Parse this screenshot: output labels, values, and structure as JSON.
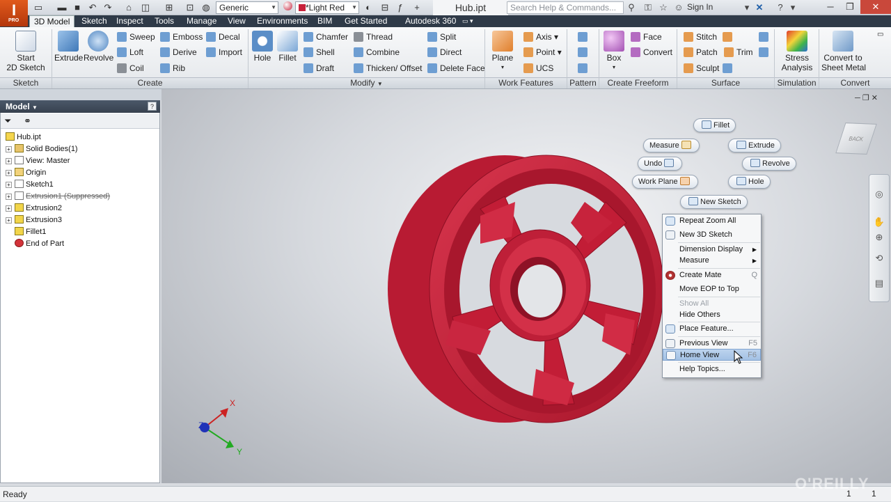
{
  "app": {
    "logo_letter": "I",
    "logo_sub": "PRO"
  },
  "titlebar": {
    "document_title": "Hub.ipt",
    "material_combo": "Generic",
    "appearance_combo": "*Light Red",
    "search_placeholder": "Search Help & Commands...",
    "sign_in": "Sign In"
  },
  "tabs": [
    "3D Model",
    "Sketch",
    "Inspect",
    "Tools",
    "Manage",
    "View",
    "Environments",
    "BIM",
    "Get Started",
    "Autodesk 360"
  ],
  "ribbon": {
    "start_sketch": "Start\n2D Sketch",
    "extrude": "Extrude",
    "revolve": "Revolve",
    "sweep": "Sweep",
    "emboss": "Emboss",
    "decal": "Decal",
    "loft": "Loft",
    "derive": "Derive",
    "import": "Import",
    "coil": "Coil",
    "rib": "Rib",
    "hole": "Hole",
    "fillet": "Fillet",
    "chamfer": "Chamfer",
    "thread": "Thread",
    "split": "Split",
    "shell": "Shell",
    "combine": "Combine",
    "direct": "Direct",
    "draft": "Draft",
    "thicken": "Thicken/ Offset",
    "delete_face": "Delete Face",
    "plane": "Plane",
    "axis": "Axis",
    "point": "Point",
    "ucs": "UCS",
    "box": "Box",
    "face": "Face",
    "convert": "Convert",
    "stitch": "Stitch",
    "patch": "Patch",
    "trim": "Trim",
    "sculpt": "Sculpt",
    "stress": "Stress\nAnalysis",
    "convert_sheet": "Convert to\nSheet Metal",
    "panels": [
      "Sketch",
      "Create",
      "Modify",
      "Work Features",
      "Pattern",
      "Create Freeform",
      "Surface",
      "Simulation",
      "Convert"
    ]
  },
  "browser": {
    "title": "Model",
    "items": [
      {
        "label": "Hub.ipt",
        "level": 0,
        "expand": false,
        "suppressed": false
      },
      {
        "label": "Solid Bodies(1)",
        "level": 1,
        "expand": true,
        "suppressed": false
      },
      {
        "label": "View: Master",
        "level": 1,
        "expand": true,
        "suppressed": false
      },
      {
        "label": "Origin",
        "level": 1,
        "expand": true,
        "suppressed": false
      },
      {
        "label": "Sketch1",
        "level": 1,
        "expand": true,
        "suppressed": false
      },
      {
        "label": "Extrusion1 (Suppressed)",
        "level": 1,
        "expand": true,
        "suppressed": true
      },
      {
        "label": "Extrusion2",
        "level": 1,
        "expand": true,
        "suppressed": false
      },
      {
        "label": "Extrusion3",
        "level": 1,
        "expand": true,
        "suppressed": false
      },
      {
        "label": "Fillet1",
        "level": 1,
        "expand": false,
        "suppressed": false
      },
      {
        "label": "End of Part",
        "level": 1,
        "expand": false,
        "suppressed": false
      }
    ]
  },
  "marking_menu": {
    "fillet": "Fillet",
    "measure": "Measure",
    "extrude": "Extrude",
    "undo": "Undo",
    "revolve": "Revolve",
    "work_plane": "Work Plane",
    "hole": "Hole",
    "new_sketch": "New Sketch"
  },
  "context_menu": {
    "items": [
      {
        "label": "Repeat Zoom All",
        "key": ""
      },
      {
        "label": "New 3D Sketch",
        "key": ""
      },
      {
        "label": "Dimension Display",
        "key": ""
      },
      {
        "label": "Measure",
        "key": ""
      },
      {
        "label": "Create Mate",
        "key": "Q"
      },
      {
        "label": "Move EOP to Top",
        "key": ""
      },
      {
        "label": "Show All",
        "key": ""
      },
      {
        "label": "Hide Others",
        "key": ""
      },
      {
        "label": "Place Feature...",
        "key": ""
      },
      {
        "label": "Previous View",
        "key": "F5"
      },
      {
        "label": "Home View",
        "key": "F6"
      },
      {
        "label": "Help Topics...",
        "key": ""
      }
    ]
  },
  "viewcube_label": "BACK",
  "triad": {
    "x": "X",
    "y": "Y",
    "z": "Z"
  },
  "status": {
    "text": "Ready",
    "count_a": "1",
    "count_b": "1"
  },
  "watermark": "O'REILLY",
  "colors": {
    "part": "#c8213a",
    "ribbon_tab_bar": "#2f3a48",
    "highlight": "#a3c1e4"
  }
}
